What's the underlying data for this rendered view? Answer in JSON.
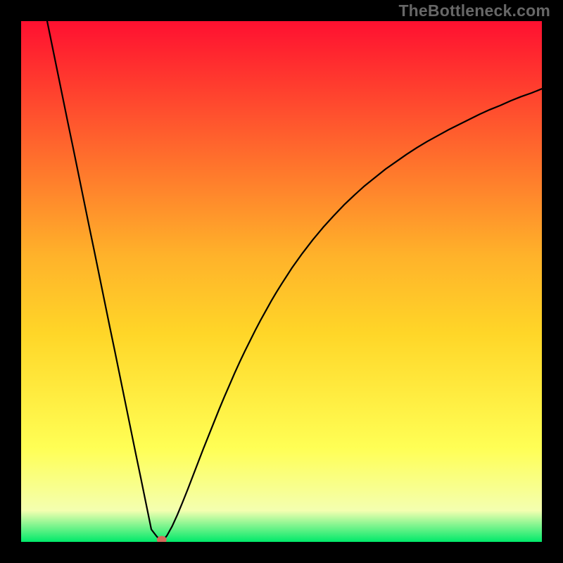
{
  "watermark": "TheBottleneck.com",
  "colors": {
    "frame": "#000000",
    "gradient_top": "#ff1030",
    "gradient_mid_upper": "#ffb22a",
    "gradient_mid": "#ffd628",
    "gradient_mid_lower": "#ffff55",
    "gradient_low": "#f4ffb0",
    "gradient_bottom": "#00e96a",
    "curve": "#000000",
    "marker": "#d46a5a"
  },
  "chart_data": {
    "type": "line",
    "title": "",
    "xlabel": "",
    "ylabel": "",
    "xlim": [
      0,
      100
    ],
    "ylim": [
      0,
      100
    ],
    "x": [
      5,
      6,
      7,
      8,
      9,
      10,
      11,
      12,
      13,
      14,
      15,
      16,
      17,
      18,
      19,
      20,
      21,
      22,
      23,
      24,
      25,
      26,
      27,
      28,
      29,
      30,
      31,
      32,
      33,
      34,
      35,
      36,
      37,
      38,
      39,
      40,
      41,
      42,
      43,
      44,
      45,
      46,
      47,
      48,
      49,
      50,
      52,
      54,
      56,
      58,
      60,
      62,
      64,
      66,
      68,
      70,
      72,
      74,
      76,
      78,
      80,
      82,
      84,
      86,
      88,
      90,
      92,
      94,
      96,
      98,
      100
    ],
    "values": [
      100,
      95.1,
      90.2,
      85.3,
      80.4,
      75.6,
      70.7,
      65.8,
      60.9,
      56.1,
      51.2,
      46.3,
      41.4,
      36.6,
      31.7,
      26.8,
      21.9,
      17.0,
      12.2,
      7.3,
      2.4,
      1.1,
      0.0,
      1.2,
      3.0,
      5.2,
      7.6,
      10.1,
      12.7,
      15.3,
      17.9,
      20.4,
      22.9,
      25.4,
      27.8,
      30.1,
      32.4,
      34.6,
      36.7,
      38.7,
      40.7,
      42.6,
      44.4,
      46.2,
      47.9,
      49.5,
      52.6,
      55.4,
      58.0,
      60.4,
      62.6,
      64.7,
      66.6,
      68.4,
      70.0,
      71.6,
      73.0,
      74.4,
      75.7,
      76.9,
      78.0,
      79.1,
      80.1,
      81.1,
      82.1,
      83.0,
      83.8,
      84.7,
      85.5,
      86.2,
      87.0
    ],
    "marker": {
      "x": 27,
      "y": 0
    },
    "gradient_stops": [
      {
        "pct": 100,
        "color": "#ff1030"
      },
      {
        "pct": 55,
        "color": "#ffb22a"
      },
      {
        "pct": 40,
        "color": "#ffd628"
      },
      {
        "pct": 18,
        "color": "#ffff55"
      },
      {
        "pct": 6,
        "color": "#f4ffb0"
      },
      {
        "pct": 0,
        "color": "#00e96a"
      }
    ]
  }
}
